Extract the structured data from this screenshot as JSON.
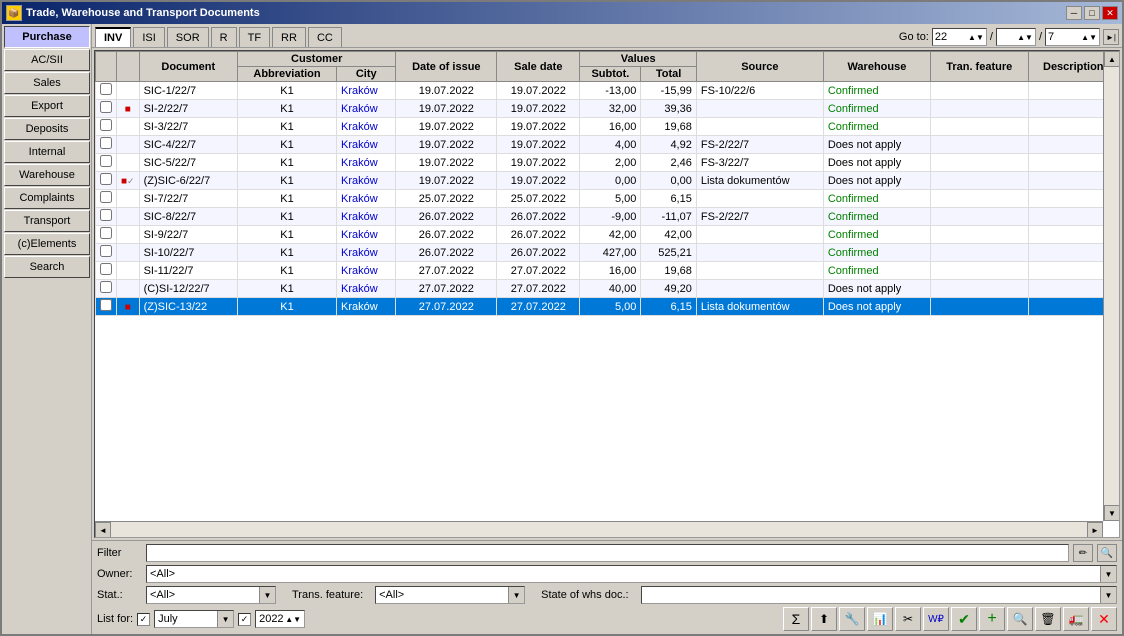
{
  "window": {
    "title": "Trade, Warehouse and Transport Documents"
  },
  "title_buttons": {
    "minimize": "─",
    "maximize": "□",
    "close": "✕"
  },
  "sidebar": {
    "items": [
      {
        "id": "purchase",
        "label": "Purchase",
        "active": true
      },
      {
        "id": "acsii",
        "label": "AC/SII",
        "active": false
      },
      {
        "id": "sales",
        "label": "Sales",
        "active": false
      },
      {
        "id": "export",
        "label": "Export",
        "active": false
      },
      {
        "id": "deposits",
        "label": "Deposits",
        "active": false
      },
      {
        "id": "internal",
        "label": "Internal",
        "active": false
      },
      {
        "id": "warehouse",
        "label": "Warehouse",
        "active": false
      },
      {
        "id": "complaints",
        "label": "Complaints",
        "active": false
      },
      {
        "id": "transport",
        "label": "Transport",
        "active": false
      },
      {
        "id": "celements",
        "label": "(c)Elements",
        "active": false
      },
      {
        "id": "search",
        "label": "Search",
        "active": false
      }
    ]
  },
  "tabs": [
    {
      "id": "inv",
      "label": "INV",
      "active": true
    },
    {
      "id": "isi",
      "label": "ISI",
      "active": false
    },
    {
      "id": "sor",
      "label": "SOR",
      "active": false
    },
    {
      "id": "r",
      "label": "R",
      "active": false
    },
    {
      "id": "tf",
      "label": "TF",
      "active": false
    },
    {
      "id": "rr",
      "label": "RR",
      "active": false
    },
    {
      "id": "cc",
      "label": "CC",
      "active": false
    }
  ],
  "goto": {
    "label": "Go to:",
    "value1": "22",
    "value2": "7",
    "sep1": "/",
    "sep2": "/"
  },
  "table": {
    "headers": {
      "document": "Document",
      "customer": "Customer",
      "abbreviation": "Abbreviation",
      "city": "City",
      "date_of_issue": "Date of issue",
      "sale_date": "Sale date",
      "values": "Values",
      "subtot": "Subtot.",
      "total": "Total",
      "source": "Source",
      "warehouse": "Warehouse",
      "tran_feature": "Tran. feature",
      "description": "Description"
    },
    "rows": [
      {
        "doc": "SIC-1/22/7",
        "icon": "",
        "abbr": "K1",
        "city": "Kraków",
        "doi": "19.07.2022",
        "sale": "19.07.2022",
        "subtot": "-13,00",
        "total": "-15,99",
        "source": "FS-10/22/6",
        "warehouse": "Confirmed",
        "tran": "",
        "desc": "",
        "selected": false
      },
      {
        "doc": "SI-2/22/7",
        "icon": "red",
        "abbr": "K1",
        "city": "Kraków",
        "doi": "19.07.2022",
        "sale": "19.07.2022",
        "subtot": "32,00",
        "total": "39,36",
        "source": "",
        "warehouse": "Confirmed",
        "tran": "",
        "desc": "",
        "selected": false
      },
      {
        "doc": "SI-3/22/7",
        "icon": "",
        "abbr": "K1",
        "city": "Kraków",
        "doi": "19.07.2022",
        "sale": "19.07.2022",
        "subtot": "16,00",
        "total": "19,68",
        "source": "",
        "warehouse": "Confirmed",
        "tran": "",
        "desc": "",
        "selected": false
      },
      {
        "doc": "SIC-4/22/7",
        "icon": "",
        "abbr": "K1",
        "city": "Kraków",
        "doi": "19.07.2022",
        "sale": "19.07.2022",
        "subtot": "4,00",
        "total": "4,92",
        "source": "FS-2/22/7",
        "warehouse": "Does not apply",
        "tran": "",
        "desc": "",
        "selected": false
      },
      {
        "doc": "SIC-5/22/7",
        "icon": "",
        "abbr": "K1",
        "city": "Kraków",
        "doi": "19.07.2022",
        "sale": "19.07.2022",
        "subtot": "2,00",
        "total": "2,46",
        "source": "FS-3/22/7",
        "warehouse": "Does not apply",
        "tran": "",
        "desc": "",
        "selected": false
      },
      {
        "doc": "(Z)SIC-6/22/7",
        "icon": "check",
        "abbr": "K1",
        "city": "Kraków",
        "doi": "19.07.2022",
        "sale": "19.07.2022",
        "subtot": "0,00",
        "total": "0,00",
        "source": "Lista dokumentów",
        "warehouse": "Does not apply",
        "tran": "",
        "desc": "",
        "selected": false
      },
      {
        "doc": "SI-7/22/7",
        "icon": "",
        "abbr": "K1",
        "city": "Kraków",
        "doi": "25.07.2022",
        "sale": "25.07.2022",
        "subtot": "5,00",
        "total": "6,15",
        "source": "",
        "warehouse": "Confirmed",
        "tran": "",
        "desc": "",
        "selected": false
      },
      {
        "doc": "SIC-8/22/7",
        "icon": "",
        "abbr": "K1",
        "city": "Kraków",
        "doi": "26.07.2022",
        "sale": "26.07.2022",
        "subtot": "-9,00",
        "total": "-11,07",
        "source": "FS-2/22/7",
        "warehouse": "Confirmed",
        "tran": "",
        "desc": "",
        "selected": false
      },
      {
        "doc": "SI-9/22/7",
        "icon": "",
        "abbr": "K1",
        "city": "Kraków",
        "doi": "26.07.2022",
        "sale": "26.07.2022",
        "subtot": "42,00",
        "total": "42,00",
        "source": "",
        "warehouse": "Confirmed",
        "tran": "",
        "desc": "",
        "selected": false
      },
      {
        "doc": "SI-10/22/7",
        "icon": "",
        "abbr": "K1",
        "city": "Kraków",
        "doi": "26.07.2022",
        "sale": "26.07.2022",
        "subtot": "427,00",
        "total": "525,21",
        "source": "",
        "warehouse": "Confirmed",
        "tran": "",
        "desc": "",
        "selected": false
      },
      {
        "doc": "SI-11/22/7",
        "icon": "",
        "abbr": "K1",
        "city": "Kraków",
        "doi": "27.07.2022",
        "sale": "27.07.2022",
        "subtot": "16,00",
        "total": "19,68",
        "source": "",
        "warehouse": "Confirmed",
        "tran": "",
        "desc": "",
        "selected": false
      },
      {
        "doc": "(C)SI-12/22/7",
        "icon": "",
        "abbr": "K1",
        "city": "Kraków",
        "doi": "27.07.2022",
        "sale": "27.07.2022",
        "subtot": "40,00",
        "total": "49,20",
        "source": "",
        "warehouse": "Does not apply",
        "tran": "",
        "desc": "",
        "selected": false
      },
      {
        "doc": "(Z)SIC-13/22",
        "icon": "red",
        "abbr": "K1",
        "city": "Kraków",
        "doi": "27.07.2022",
        "sale": "27.07.2022",
        "subtot": "5,00",
        "total": "6,15",
        "source": "Lista dokumentów",
        "warehouse": "Does not apply",
        "tran": "",
        "desc": "",
        "selected": true
      }
    ]
  },
  "filter": {
    "label": "Filter",
    "value": ""
  },
  "owner": {
    "label": "Owner:",
    "value": "<All>"
  },
  "stat": {
    "label": "Stat.:",
    "value": "<All>",
    "trans_feature_label": "Trans. feature:",
    "trans_feature_value": "<All>",
    "state_whs_label": "State of whs doc.:",
    "state_whs_value": ""
  },
  "listfor": {
    "label": "List for:",
    "month": "July",
    "year": "2022"
  },
  "toolbar": {
    "buttons": [
      "Σ",
      "⬆",
      "🔧",
      "📊",
      "✂",
      "W₽",
      "✔",
      "+",
      "🔍",
      "🗑",
      "🚛",
      "✕"
    ]
  },
  "scroll": {
    "left": "◄",
    "right": "►",
    "up": "▲",
    "down": "▼"
  }
}
